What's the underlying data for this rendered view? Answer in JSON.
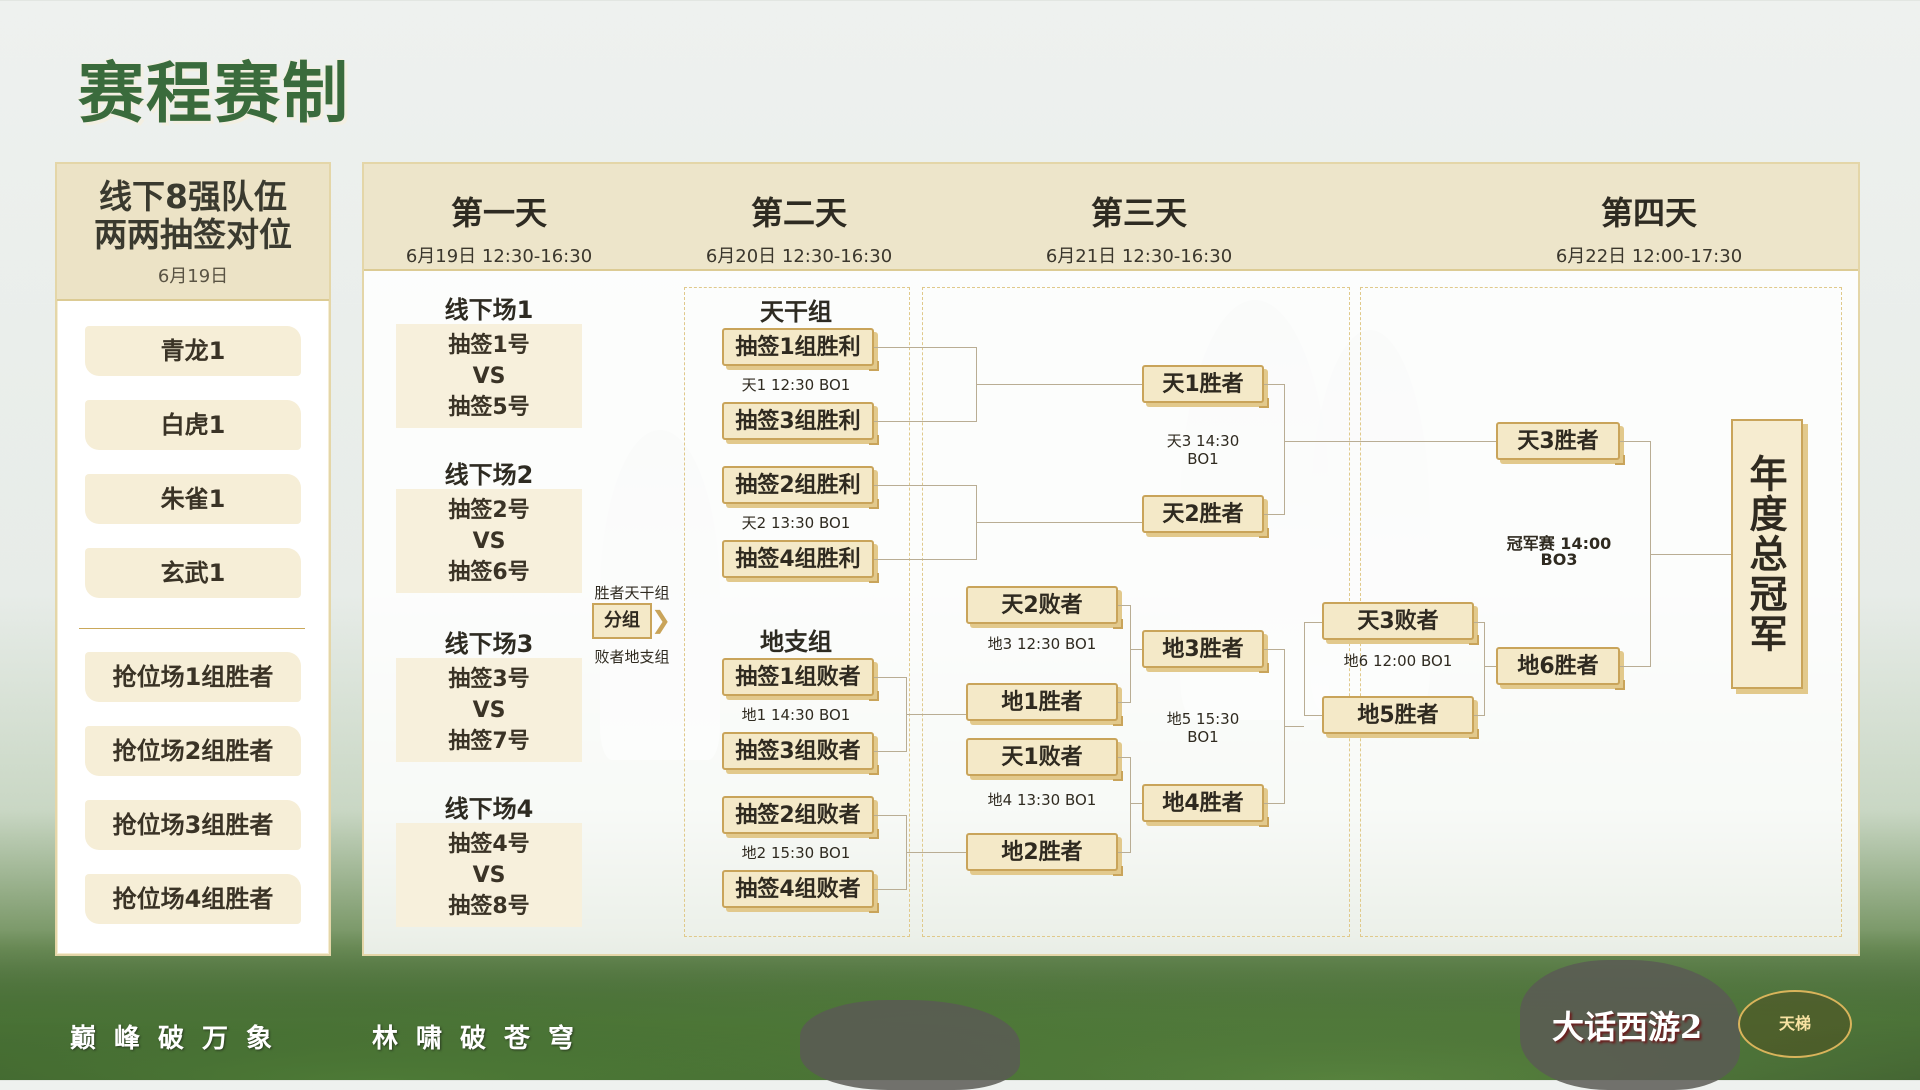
{
  "title": "赛程赛制",
  "left_panel": {
    "heading_line1": "线下8强队伍",
    "heading_line2": "两两抽签对位",
    "date": "6月19日",
    "teams": [
      "青龙1",
      "白虎1",
      "朱雀1",
      "玄武1"
    ],
    "qualifiers": [
      "抢位场1组胜者",
      "抢位场2组胜者",
      "抢位场3组胜者",
      "抢位场4组胜者"
    ]
  },
  "days": [
    {
      "name": "第一天",
      "time": "6月19日 12:30-16:30"
    },
    {
      "name": "第二天",
      "time": "6月20日 12:30-16:30"
    },
    {
      "name": "第三天",
      "time": "6月21日 12:30-16:30"
    },
    {
      "name": "第四天",
      "time": "6月22日 12:00-17:30"
    }
  ],
  "day1": {
    "matches": [
      {
        "label": "线下场1",
        "top": "抽签1号",
        "vs": "VS",
        "bottom": "抽签5号"
      },
      {
        "label": "线下场2",
        "top": "抽签2号",
        "vs": "VS",
        "bottom": "抽签6号"
      },
      {
        "label": "线下场3",
        "top": "抽签3号",
        "vs": "VS",
        "bottom": "抽签7号"
      },
      {
        "label": "线下场4",
        "top": "抽签4号",
        "vs": "VS",
        "bottom": "抽签8号"
      }
    ],
    "split_top": "胜者天干组",
    "split_label": "分组",
    "split_bottom": "败者地支组"
  },
  "day2": {
    "tiangan_title": "天干组",
    "dizhi_title": "地支组",
    "tiangan": [
      {
        "a": "抽签1组胜利",
        "info": "天1 12:30 BO1",
        "b": "抽签3组胜利"
      },
      {
        "a": "抽签2组胜利",
        "info": "天2 13:30 BO1",
        "b": "抽签4组胜利"
      }
    ],
    "dizhi": [
      {
        "a": "抽签1组败者",
        "info": "地1 14:30 BO1",
        "b": "抽签3组败者"
      },
      {
        "a": "抽签2组败者",
        "info": "地2 15:30 BO1",
        "b": "抽签4组败者"
      }
    ]
  },
  "day3": {
    "tian1": "天1胜者",
    "tian2": "天2胜者",
    "tian3_info_1": "天3 14:30",
    "tian3_info_2": "BO1",
    "tian2_loser": "天2败者",
    "di3_info": "地3 12:30 BO1",
    "di1_winner": "地1胜者",
    "tian1_loser": "天1败者",
    "di4_info": "地4 13:30 BO1",
    "di2_winner": "地2胜者",
    "di3_winner": "地3胜者",
    "di4_winner": "地4胜者",
    "di5_info_1": "地5 15:30",
    "di5_info_2": "BO1"
  },
  "day4": {
    "tian3_winner": "天3胜者",
    "final_info_1": "冠军赛 14:00",
    "final_info_2": "BO3",
    "tian3_loser": "天3败者",
    "di6_info": "地6 12:00 BO1",
    "di5_winner": "地5胜者",
    "di6_winner": "地6胜者",
    "champion": "年度总冠军"
  },
  "footer": {
    "slogan_1": "巅峰破万象",
    "slogan_2": "林啸破苍穹",
    "logo_1": "大话西游2",
    "logo_2": "天梯"
  }
}
